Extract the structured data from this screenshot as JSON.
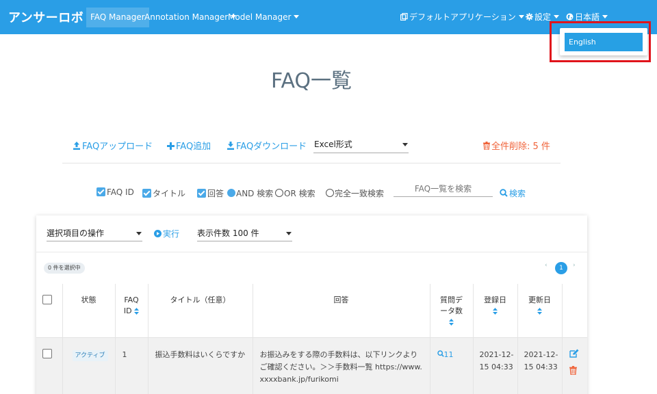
{
  "navbar": {
    "brand": "アンサーロボ",
    "items": [
      "FAQ Manager",
      "Annotation Manager",
      "Model Manager"
    ],
    "default_app": "デフォルトアプリケーション",
    "settings": "設定",
    "language": "日本語",
    "color": "#2a9ee6"
  },
  "language_menu": {
    "options": [
      "English"
    ]
  },
  "page": {
    "title": "FAQ一覧"
  },
  "toolbar": {
    "upload": "FAQアップロード",
    "add": "FAQ追加",
    "download": "FAQダウンロード",
    "format": "Excel形式",
    "delete_all": "全件削除: 5 件"
  },
  "search": {
    "fields": [
      "FAQ ID",
      "タイトル",
      "回答"
    ],
    "mode_and": "AND 検索",
    "mode_or": "OR 検索",
    "mode_exact": "完全一致検索",
    "placeholder": "FAQ一覧を検索",
    "button": "検索"
  },
  "list": {
    "bulk_action": "選択項目の操作",
    "run": "実行",
    "page_size": "表示件数 100 件",
    "selected": "0 件を選択中",
    "current_page": "1",
    "columns": {
      "status": "状態",
      "faq_id_line1": "FAQ",
      "faq_id_line2": "ID",
      "title": "タイトル（任意）",
      "answer": "回答",
      "qcount_line1": "質問デ",
      "qcount_line2": "ータ数",
      "created": "登録日",
      "updated": "更新日"
    },
    "rows": [
      {
        "status": "アクティブ",
        "faq_id": "1",
        "title": "振込手数料はいくらですか",
        "answer": "お振込みをする際の手数料は、以下リンクよりご確認ください。＞＞手数料一覧 https://www.xxxxbank.jp/furikomi",
        "question_count": "11",
        "created": "2021-12-15 04:33",
        "updated": "2021-12-15 04:33"
      }
    ]
  }
}
